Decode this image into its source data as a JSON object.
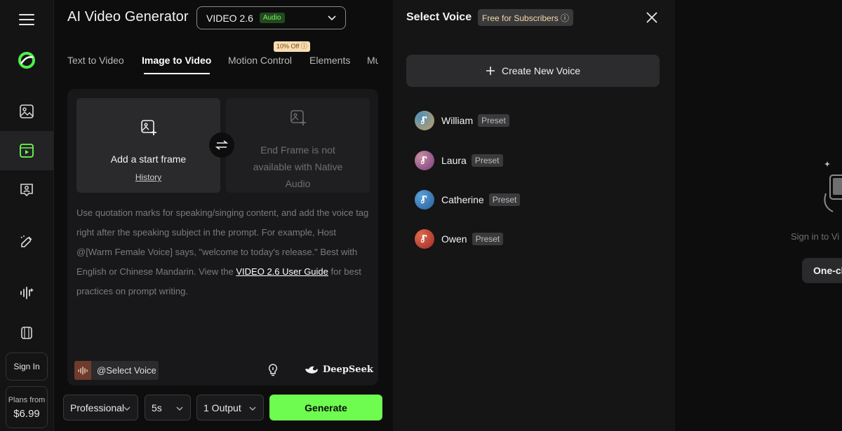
{
  "app": {
    "title": "AI Video Generator",
    "model": {
      "name": "VIDEO 2.6",
      "badge": "Audio"
    }
  },
  "sidebar": {
    "items": [
      {
        "icon": "menu-icon"
      },
      {
        "icon": "logo-icon"
      },
      {
        "icon": "image-icon"
      },
      {
        "icon": "video-icon",
        "active": true
      },
      {
        "icon": "avatar-icon"
      },
      {
        "icon": "effects-icon"
      },
      {
        "icon": "audio-icon"
      },
      {
        "icon": "assets-icon"
      }
    ],
    "sign_in": "Sign In",
    "plans": {
      "label": "Plans from",
      "price": "$6.99"
    }
  },
  "tabs": [
    {
      "label": "Text to Video"
    },
    {
      "label": "Image to Video",
      "active": true
    },
    {
      "label": "Motion Control",
      "badge": "10% Off ⓘ"
    },
    {
      "label": "Elements"
    },
    {
      "label": "Mu"
    }
  ],
  "frames": {
    "start": {
      "title": "Add a start frame",
      "link": "History"
    },
    "end": {
      "text": "End Frame is not available with Native Audio"
    }
  },
  "prompt": {
    "text_before": "Use quotation marks for speaking/singing content, and add the voice tag right after the speaking subject in the prompt. For example, Host @[Warm Female Voice] says, \"welcome to today's release.\" Best with English or Chinese Mandarin. View the ",
    "link": "VIDEO 2.6 User Guide",
    "text_after": " for best practices on prompt writing."
  },
  "toolbar": {
    "voice_chip": "@Select Voice",
    "deepseek": "DeepSeek"
  },
  "controls": {
    "mode": "Professional",
    "duration": "5s",
    "outputs": "1 Output",
    "generate": "Generate"
  },
  "voice_panel": {
    "title": "Select Voice",
    "badge": "Free for Subscribers ⓘ",
    "create": "Create New Voice",
    "voices": [
      {
        "name": "William",
        "tag": "Preset",
        "color": "#c8a05a"
      },
      {
        "name": "Laura",
        "tag": "Preset",
        "color": "#b86aa0"
      },
      {
        "name": "Catherine",
        "tag": "Preset",
        "color": "#3d86c2"
      },
      {
        "name": "Owen",
        "tag": "Preset",
        "color": "#c8453a"
      }
    ]
  },
  "preview": {
    "sign_in_text": "Sign in to Vi",
    "button": "One-cl"
  },
  "colors": {
    "accent": "#6dfc4f",
    "audio_badge_bg": "#214a1f",
    "audio_badge_text": "#7ff05a",
    "discount_bg": "#f7ddb0"
  }
}
